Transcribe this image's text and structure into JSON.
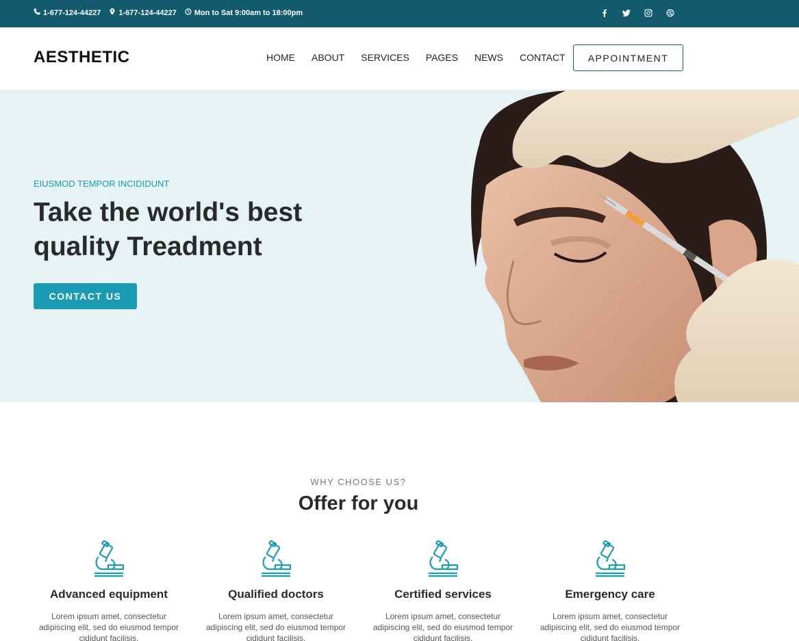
{
  "topbar": {
    "phone1": "1-677-124-44227",
    "phone2": "1-677-124-44227",
    "hours": "Mon to Sat 9:00am to 18:00pm",
    "social": [
      "facebook-icon",
      "twitter-icon",
      "instagram-icon",
      "dribbble-icon"
    ]
  },
  "header": {
    "logo": "AESTHETIC",
    "nav": [
      "HOME",
      "ABOUT",
      "SERVICES",
      "PAGES",
      "NEWS",
      "CONTACT"
    ],
    "appointment_label": "APPOINTMENT"
  },
  "hero": {
    "eyebrow": "EIUSMOD TEMPOR INCIDIDUNT",
    "title": "Take the world's best quality Treadment",
    "cta_label": "CONTACT US"
  },
  "why": {
    "eyebrow": "WHY CHOOSE US?",
    "title": "Offer for you",
    "features": [
      {
        "title": "Advanced equipment",
        "text": "Lorem ipsum amet, consectetur adipiscing elit, sed do eiusmod tempor cididunt facilisis."
      },
      {
        "title": "Qualified doctors",
        "text": "Lorem ipsum amet, consectetur adipiscing elit, sed do eiusmod tempor cididunt facilisis."
      },
      {
        "title": "Certified services",
        "text": "Lorem ipsum amet, consectetur adipiscing elit, sed do eiusmod tempor cididunt facilisis."
      },
      {
        "title": "Emergency care",
        "text": "Lorem ipsum amet, consectetur adipiscing elit, sed do eiusmod tempor cididunt facilisis."
      }
    ],
    "icon": "microscope-icon"
  },
  "colors": {
    "topbar": "#135b6c",
    "accent": "#1a9bb3",
    "hero_bg": "#e6f2f4"
  }
}
